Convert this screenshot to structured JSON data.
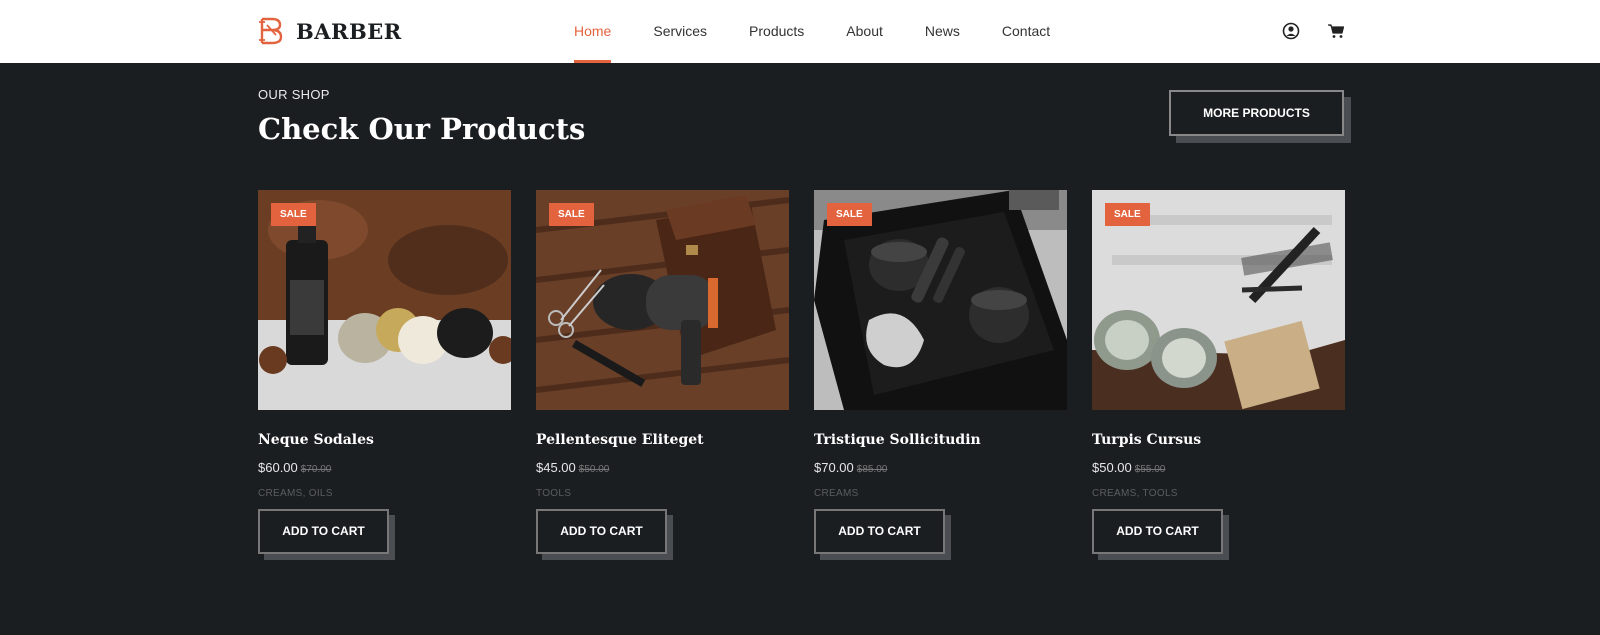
{
  "brand": {
    "name": "BARBER",
    "accent": "#e4633f"
  },
  "nav": {
    "items": [
      {
        "label": "Home",
        "active": true
      },
      {
        "label": "Services"
      },
      {
        "label": "Products"
      },
      {
        "label": "About"
      },
      {
        "label": "News"
      },
      {
        "label": "Contact"
      }
    ]
  },
  "header_icons": [
    "user-icon",
    "cart-icon"
  ],
  "section": {
    "eyebrow": "OUR SHOP",
    "title": "Check Our Products",
    "more_label": "MORE PRODUCTS"
  },
  "products": [
    {
      "badge": "SALE",
      "name": "Neque Sodales",
      "price": "$60.00",
      "old_price": "$70.00",
      "categories": "CREAMS, OILS",
      "cta": "ADD TO CART"
    },
    {
      "badge": "SALE",
      "name": "Pellentesque Eliteget",
      "price": "$45.00",
      "old_price": "$50.00",
      "categories": "TOOLS",
      "cta": "ADD TO CART"
    },
    {
      "badge": "SALE",
      "name": "Tristique Sollicitudin",
      "price": "$70.00",
      "old_price": "$85.00",
      "categories": "CREAMS",
      "cta": "ADD TO CART"
    },
    {
      "badge": "SALE",
      "name": "Turpis Cursus",
      "price": "$50.00",
      "old_price": "$55.00",
      "categories": "CREAMS, TOOLS",
      "cta": "ADD TO CART"
    }
  ]
}
